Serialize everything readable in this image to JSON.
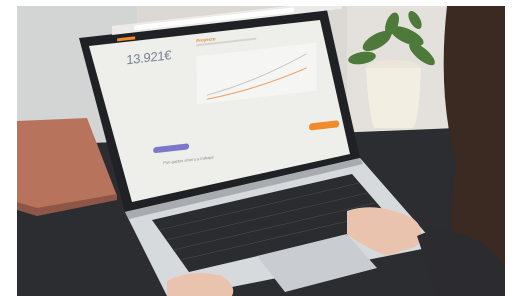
{
  "photo": {
    "subject": "laptop-on-desk-with-hands",
    "colors": {
      "wall": "#d9d6d2",
      "desk": "#2b2d31",
      "laptop_body": "#d7dadd",
      "screen_bg": "#eeeeeb",
      "accent_orange": "#f08a2a",
      "accent_purple": "#7c78c8",
      "notebook": "#b8735d",
      "plant_pot": "#f3eee2",
      "plant_leaves": "#4d7a3a"
    }
  },
  "screen": {
    "balance_label": "",
    "balance_value": "13.921€",
    "panel_title": "Proyecto",
    "footer_text": "Pon gastos ahorro a trabajar"
  }
}
